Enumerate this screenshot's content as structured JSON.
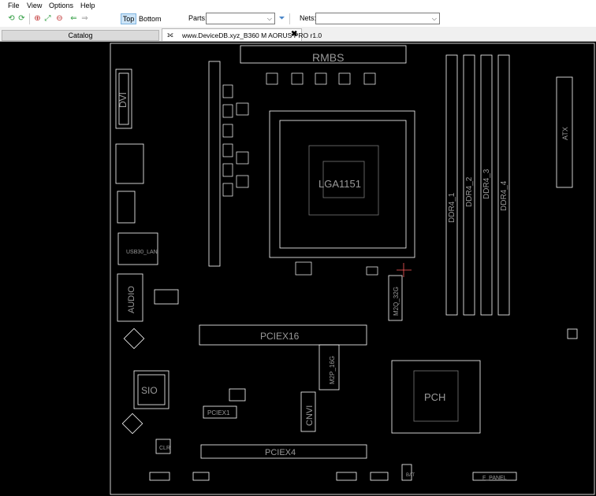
{
  "menu": [
    "File",
    "View",
    "Options",
    "Help"
  ],
  "toolbar": {
    "top_label": "Top",
    "bottom_label": "Bottom",
    "parts_label": "Parts:",
    "parts_value": "",
    "nets_label": "Nets:",
    "nets_value": ""
  },
  "tabs": {
    "catalog": "Catalog",
    "board": "www.DeviceDB.xyz_B360 M AORUS PRO r1.0"
  },
  "board_labels": {
    "rmbs": "RMBS",
    "dvi": "DVI",
    "lga": "LGA1151",
    "ddr1": "DDR4_1",
    "ddr2": "DDR4_2",
    "ddr3": "DDR4_3",
    "ddr4": "DDR4_4",
    "atx": "ATX",
    "audio": "AUDIO",
    "usb_lan": "USB30_LAN",
    "m2q": "M2Q_32G",
    "pciex16": "PCIEX16",
    "m2p": "M2P_16G",
    "sio": "SIO",
    "pciex1": "PCIEX1",
    "cnvi": "CNVI",
    "pciex4": "PCIEX4",
    "pch": "PCH",
    "clr": "CLR",
    "f_panel": "F_PANEL",
    "bat": "BAT"
  },
  "colors": {
    "board_bg": "#000000",
    "silkscreen": "#ffffff",
    "label": "#9a9a9a",
    "crosshair": "#ff5a5a"
  }
}
